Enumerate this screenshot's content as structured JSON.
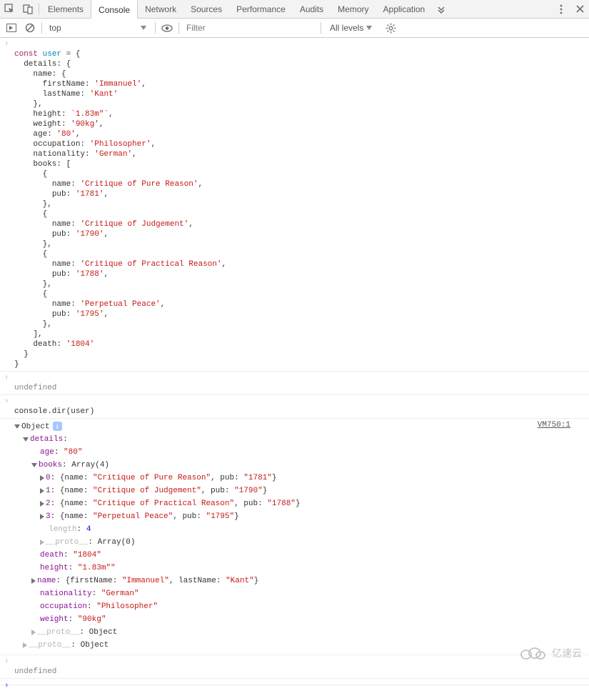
{
  "tabs": {
    "items": [
      "Elements",
      "Console",
      "Network",
      "Sources",
      "Performance",
      "Audits",
      "Memory",
      "Application"
    ],
    "active": "Console"
  },
  "toolbar": {
    "context": "top",
    "filter_placeholder": "Filter",
    "levels_label": "All levels"
  },
  "entry_code": {
    "line1_kw": "const",
    "line1_var": "user",
    "line1_rest": " = {",
    "details_open": "details: {",
    "name_open": "name: {",
    "firstName_key": "firstName:",
    "firstName_val": "'Immanuel'",
    "lastName_key": "lastName:",
    "lastName_val": "'Kant'",
    "close_brace_comma": "},",
    "height_key": "height:",
    "height_val": "`1.83m\"`",
    "weight_key": "weight:",
    "weight_val": "'90kg'",
    "age_key": "age:",
    "age_val": "'80'",
    "occupation_key": "occupation:",
    "occupation_val": "'Philosopher'",
    "nationality_key": "nationality:",
    "nationality_val": "'German'",
    "books_open": "books: [",
    "open_obj": "{",
    "book_name_key": "name:",
    "book_pub_key": "pub:",
    "book0_name": "'Critique of Pure Reason'",
    "book0_pub": "'1781'",
    "book1_name": "'Critique of Judgement'",
    "book1_pub": "'1790'",
    "book2_name": "'Critique of Practical Reason'",
    "book2_pub": "'1788'",
    "book3_name": "'Perpetual Peace'",
    "book3_pub": "'1795'",
    "books_close": "],",
    "death_key": "death:",
    "death_val": "'1804'",
    "close_brace": "}",
    "comma": ","
  },
  "result_undefined": "undefined",
  "entry2": "console.dir(user)",
  "source_link": "VM750:1",
  "dir": {
    "object_label": "Object",
    "details_label": "details",
    "age_k": "age",
    "age_v": "\"80\"",
    "books_k": "books",
    "books_v": "Array(4)",
    "idx0": "0",
    "idx1": "1",
    "idx2": "2",
    "idx3": "3",
    "book_preview_open": "{name: ",
    "book_preview_mid": ", pub: ",
    "book_preview_close": "}",
    "b0_name": "\"Critique of Pure Reason\"",
    "b0_pub": "\"1781\"",
    "b1_name": "\"Critique of Judgement\"",
    "b1_pub": "\"1790\"",
    "b2_name": "\"Critique of Practical Reason\"",
    "b2_pub": "\"1788\"",
    "b3_name": "\"Perpetual Peace\"",
    "b3_pub": "\"1795\"",
    "length_k": "length",
    "length_v": "4",
    "proto_k": "__proto__",
    "proto_arr_v": "Array(0)",
    "death_k": "death",
    "death_v": "\"1804\"",
    "height_k": "height",
    "height_v": "\"1.83m\"\"",
    "name_k": "name",
    "name_preview": "{firstName: \"Immanuel\", lastName: \"Kant\"}",
    "name_fn": "\"Immanuel\"",
    "name_ln": "\"Kant\"",
    "nationality_k": "nationality",
    "nationality_v": "\"German\"",
    "occupation_k": "occupation",
    "occupation_v": "\"Philosopher\"",
    "weight_k": "weight",
    "weight_v": "\"90kg\"",
    "proto_obj_v": "Object"
  },
  "watermark_text": "亿速云"
}
